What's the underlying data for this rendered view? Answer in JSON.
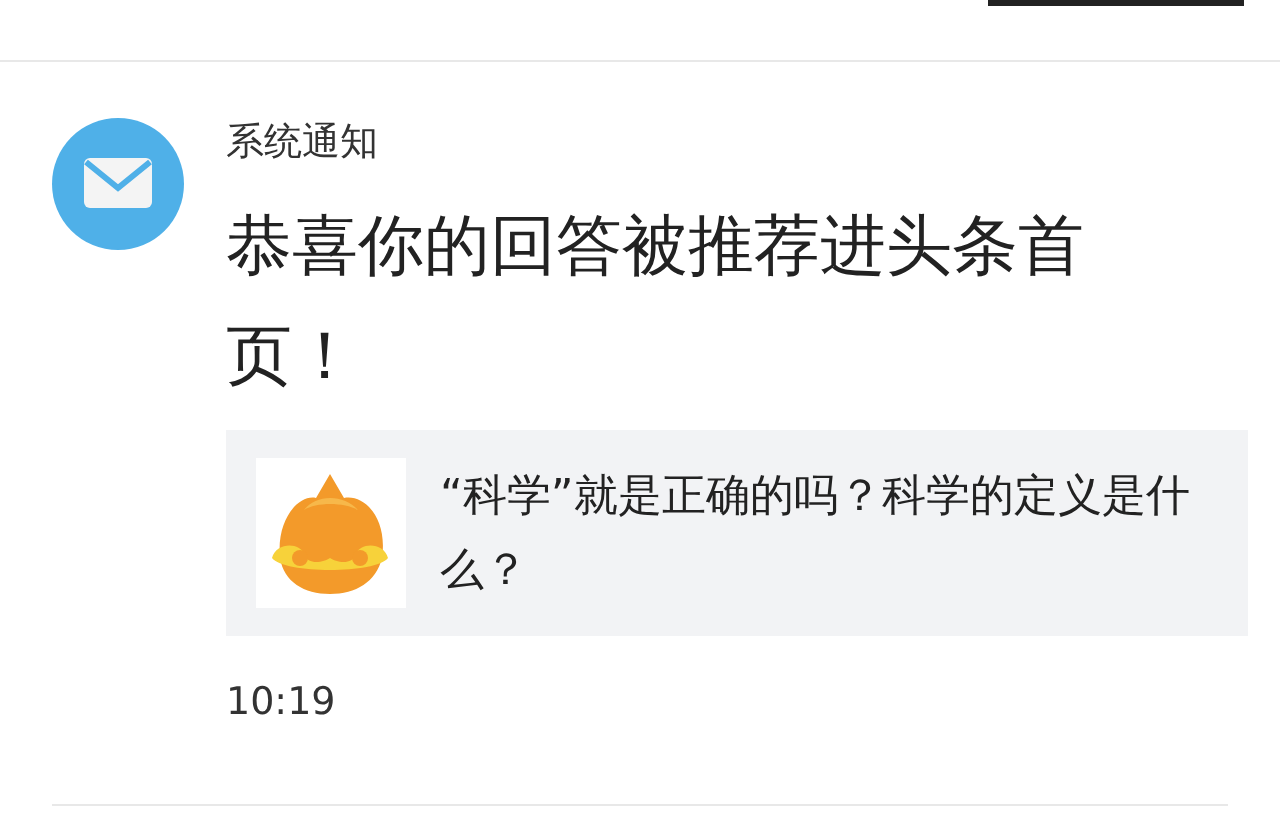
{
  "notification": {
    "sender": "系统通知",
    "message": "恭喜你的回答被推荐进头条首页！",
    "attachment": {
      "kind": "picture",
      "title": "“科学”就是正确的吗？科学的定义是什么？"
    },
    "time": "10:19"
  }
}
